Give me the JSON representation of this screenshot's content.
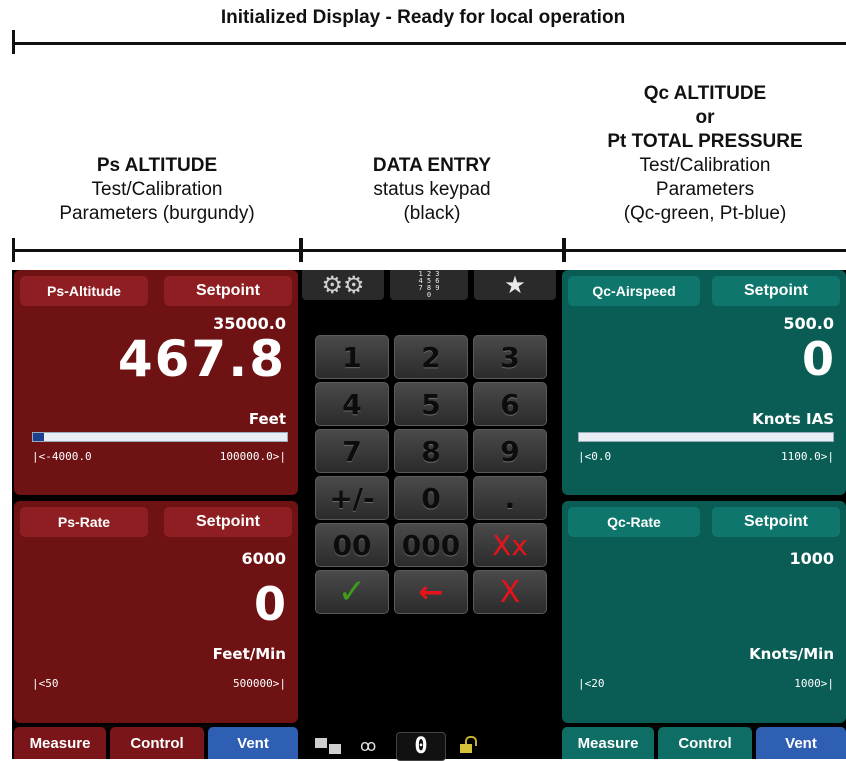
{
  "header": {
    "title": "Initialized Display - Ready for local operation"
  },
  "columns": {
    "left": {
      "line1": "Ps ALTITUDE",
      "line2": "Test/Calibration",
      "line3": "Parameters (burgundy)"
    },
    "middle": {
      "line1": "DATA ENTRY",
      "line2": "status keypad",
      "line3": "(black)"
    },
    "right": {
      "line0a": "Qc ALTITUDE",
      "line0b": "or",
      "line1": "Pt TOTAL PRESSURE",
      "line2": "Test/Calibration",
      "line3": "Parameters",
      "line4": "(Qc-green, Pt-blue)"
    }
  },
  "colors": {
    "burgundy": "#6e1214",
    "teal": "#0a5d55",
    "vent_blue": "#2f5fb3"
  },
  "ps_altitude": {
    "tab_label": "Ps-Altitude",
    "setpoint_label": "Setpoint",
    "setpoint_value": "35000.0",
    "reading": "467.8",
    "unit": "Feet",
    "range_min": "|<-4000.0",
    "range_max": "100000.0>|",
    "bar_fraction": 0.043
  },
  "ps_rate": {
    "tab_label": "Ps-Rate",
    "setpoint_label": "Setpoint",
    "setpoint_value": "6000",
    "reading": "0",
    "unit": "Feet/Min",
    "range_min": "|<50",
    "range_max": "500000>|"
  },
  "qc_airspeed": {
    "tab_label": "Qc-Airspeed",
    "setpoint_label": "Setpoint",
    "setpoint_value": "500.0",
    "reading": "0",
    "unit": "Knots IAS",
    "range_min": "|<0.0",
    "range_max": "1100.0>|",
    "bar_fraction": 0
  },
  "qc_rate": {
    "tab_label": "Qc-Rate",
    "setpoint_label": "Setpoint",
    "setpoint_value": "1000",
    "reading": "",
    "unit": "Knots/Min",
    "range_min": "|<20",
    "range_max": "1000>|"
  },
  "keypad": {
    "top_icons": [
      "gears-icon",
      "keypad-numbers-icon",
      "star-icon"
    ],
    "numpad_icon_text": "1 2 3\n4 5 6\n7 8 9\n0",
    "keys": [
      "1",
      "2",
      "3",
      "4",
      "5",
      "6",
      "7",
      "8",
      "9",
      "+/-",
      "0",
      ".",
      "00",
      "000"
    ],
    "clear_all_symbol": "Xx",
    "enter_symbol": "✓",
    "backspace_symbol": "←",
    "clear_symbol": "X",
    "status_zero": "0"
  },
  "left_buttons": {
    "measure": "Measure",
    "control": "Control",
    "vent": "Vent"
  },
  "right_buttons": {
    "measure": "Measure",
    "control": "Control",
    "vent": "Vent"
  }
}
